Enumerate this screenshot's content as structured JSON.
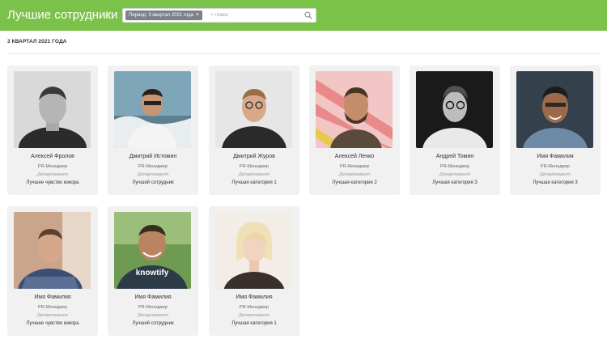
{
  "header": {
    "title": "Лучшие сотрудники",
    "filter_chip": "Период: 3 квартал 2021 года",
    "search_placeholder": "+ Поиск"
  },
  "section": {
    "heading": "3 КВАРТАЛ 2021 ГОДА"
  },
  "colors": {
    "header_bg": "#7bc24b",
    "card_bg": "#f1f1f1"
  },
  "employees": [
    {
      "name": "Алексей Фролов",
      "role": "PR-Менеджер",
      "dept": "Департамент",
      "award": "Лучшее чувство юмора"
    },
    {
      "name": "Дмитрий Истомин",
      "role": "PR-Менеджер",
      "dept": "Департамент",
      "award": "Лучший сотрудник"
    },
    {
      "name": "Дмитрий Журов",
      "role": "PR-Менеджер",
      "dept": "Департамент",
      "award": "Лучшая категория 1"
    },
    {
      "name": "Алексей Ленко",
      "role": "PR-Менеджер",
      "dept": "Департамент",
      "award": "Лучшая категория 2"
    },
    {
      "name": "Андрей Томин",
      "role": "PR-Менеджер",
      "dept": "Департамент",
      "award": "Лучшая категория 3"
    },
    {
      "name": "Имя Фамилия",
      "role": "PR-Менеджер",
      "dept": "Департамент",
      "award": "Лучшая категория 3"
    },
    {
      "name": "Имя Фамилия",
      "role": "PR-Менеджер",
      "dept": "Департамент",
      "award": "Лучшее чувство юмора"
    },
    {
      "name": "Имя Фамилия",
      "role": "PR-Менеджер",
      "dept": "Департамент",
      "award": "Лучший сотрудник"
    },
    {
      "name": "Имя Фамилия",
      "role": "PR-Менеджер",
      "dept": "Департамент",
      "award": "Лучшая категория 1"
    }
  ]
}
